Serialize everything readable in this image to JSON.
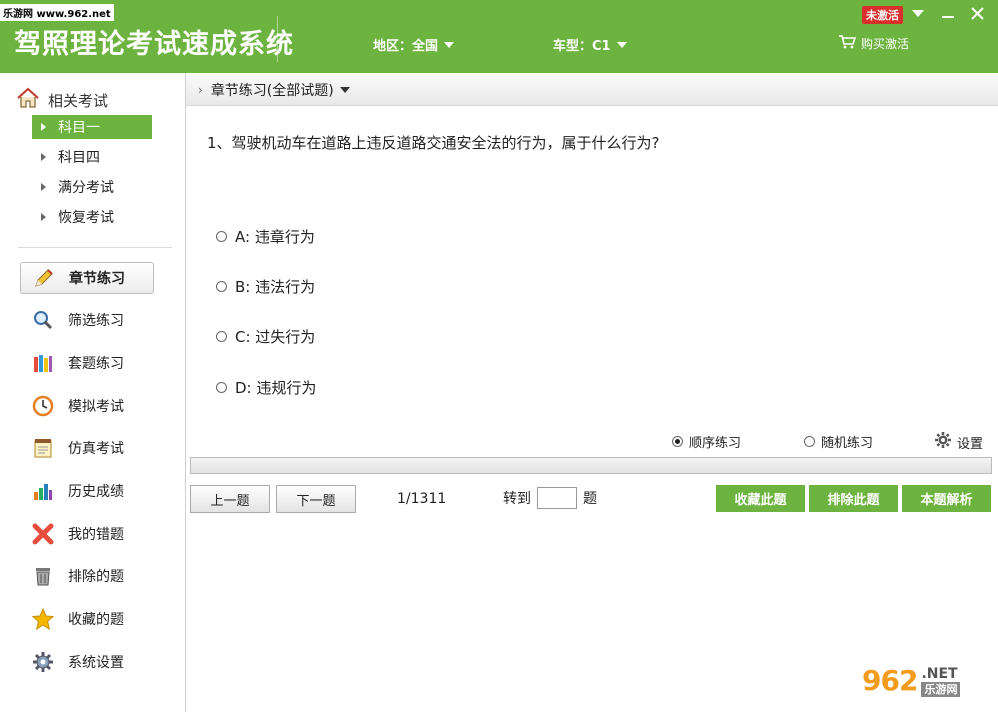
{
  "watermark_top": "乐游网 www.962.net",
  "header": {
    "title": "驾照理论考试速成系统",
    "region_label": "地区：全国",
    "vehicle_label": "车型：C1",
    "buy_label": "购买激活",
    "status_badge": "未激活",
    "accent": "#6db33f"
  },
  "sidebar": {
    "related_title": "相关考试",
    "subjects": [
      "科目一",
      "科目四",
      "满分考试",
      "恢复考试"
    ],
    "nav": [
      {
        "label": "章节练习",
        "icon": "pencil-icon"
      },
      {
        "label": "筛选练习",
        "icon": "magnifier-icon"
      },
      {
        "label": "套题练习",
        "icon": "books-icon"
      },
      {
        "label": "模拟考试",
        "icon": "clock-icon"
      },
      {
        "label": "仿真考试",
        "icon": "notepad-icon"
      },
      {
        "label": "历史成绩",
        "icon": "bar-chart-icon"
      },
      {
        "label": "我的错题",
        "icon": "x-mark-icon"
      },
      {
        "label": "排除的题",
        "icon": "trash-icon"
      },
      {
        "label": "收藏的题",
        "icon": "star-icon"
      },
      {
        "label": "系统设置",
        "icon": "gear-icon"
      }
    ]
  },
  "breadcrumb": "章节练习(全部试题)",
  "question": {
    "text": "1、驾驶机动车在道路上违反道路交通安全法的行为，属于什么行为?",
    "options": [
      "A: 违章行为",
      "B: 违法行为",
      "C: 过失行为",
      "D: 违规行为"
    ]
  },
  "modes": {
    "sequential": "顺序练习",
    "random": "随机练习",
    "settings": "设置"
  },
  "controls": {
    "prev": "上一题",
    "next": "下一题",
    "page": "1/1311",
    "goto_label": "转到",
    "goto_suffix": "题",
    "goto_value": "",
    "favorite": "收藏此题",
    "exclude": "排除此题",
    "explain": "本题解析"
  },
  "watermark_bottom": {
    "big": "962",
    "net": ".NET",
    "cn": "乐游网"
  }
}
